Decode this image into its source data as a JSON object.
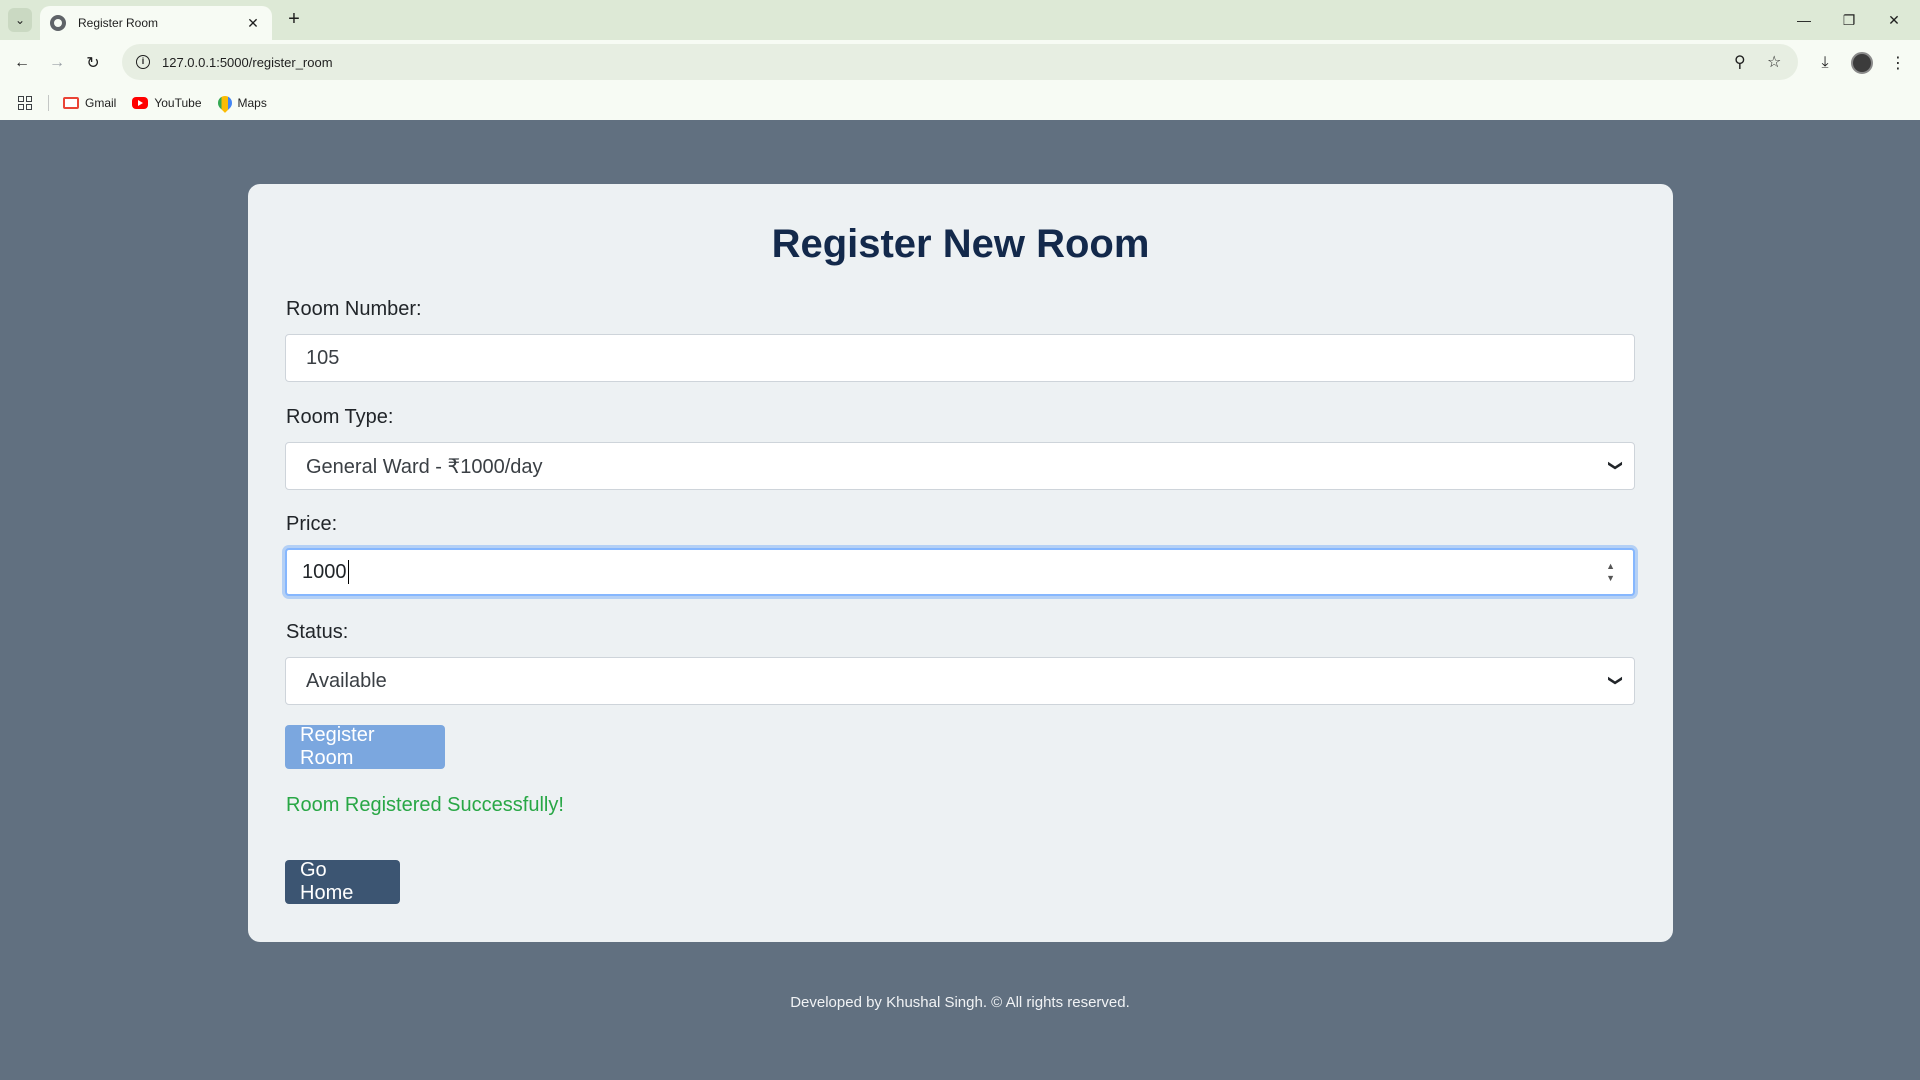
{
  "browser": {
    "tab_title": "Register Room",
    "new_tab_symbol": "+",
    "url": "127.0.0.1:5000/register_room",
    "bookmarks": [
      {
        "label": "Gmail",
        "icon": "gmail-icon"
      },
      {
        "label": "YouTube",
        "icon": "youtube-icon"
      },
      {
        "label": "Maps",
        "icon": "maps-icon"
      }
    ]
  },
  "form": {
    "title": "Register New Room",
    "room_number_label": "Room Number:",
    "room_number_value": "105",
    "room_type_label": "Room Type:",
    "room_type_value": "General Ward - ₹1000/day",
    "price_label": "Price:",
    "price_value": "1000",
    "status_label": "Status:",
    "status_value": "Available",
    "register_button": "Register Room",
    "success_message": "Room Registered Successfully!",
    "home_button": "Go Home"
  },
  "footer": {
    "text": "Developed by Khushal Singh. © All rights reserved."
  },
  "colors": {
    "page_background": "#617080",
    "card_background": "#edf1f3",
    "title": "#13294b",
    "success": "#28a745",
    "register_button": "#7ba7df",
    "home_button": "#3c5572"
  }
}
